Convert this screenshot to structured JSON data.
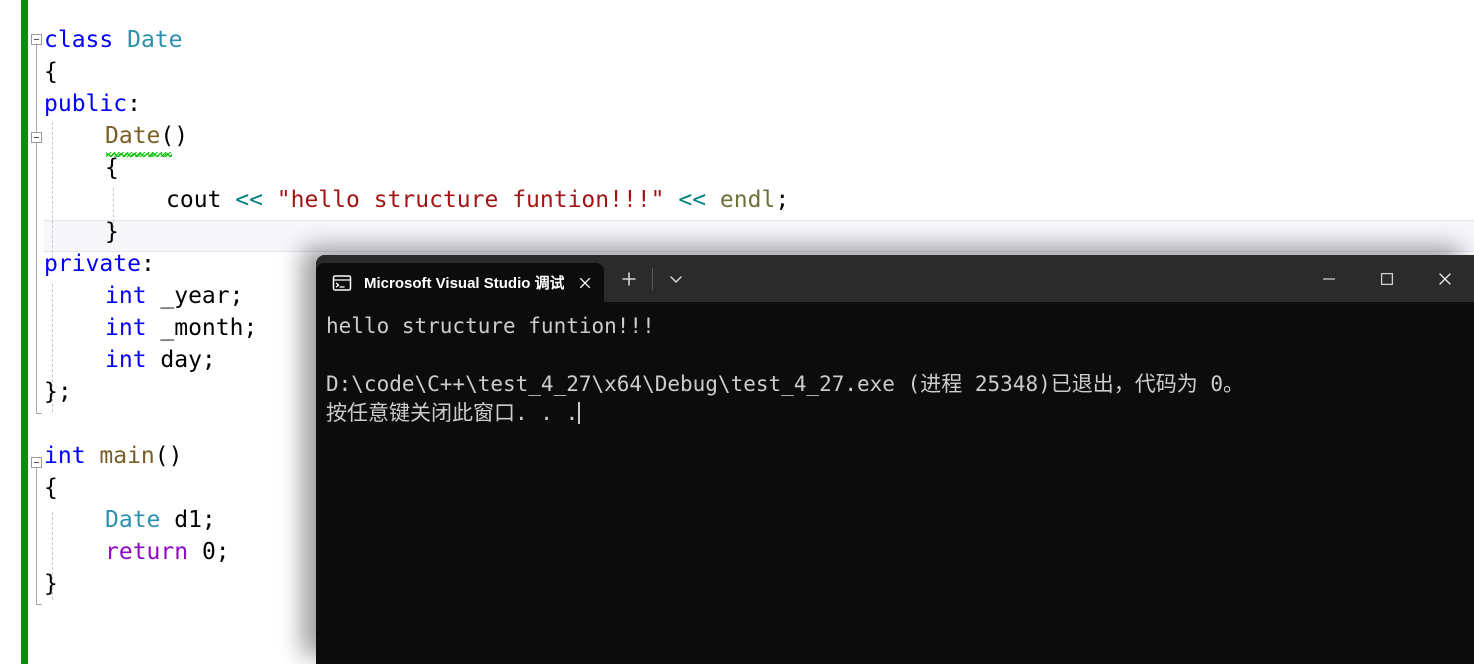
{
  "editor": {
    "name": "visual-studio-code-editor",
    "colors": {
      "background": "#ffffff",
      "change_bar": "#108b10",
      "keyword": "#0000ff",
      "control_keyword": "#8f08c4",
      "type": "#2b91af",
      "function": "#795e26",
      "string": "#a31515",
      "operator": "#008080",
      "macro": "#6f6f3a",
      "current_line_bg": "#f6f6fb",
      "error_squiggle": "#00cc00"
    },
    "lines": [
      {
        "indent": 0,
        "tokens": [
          {
            "t": "class ",
            "c": "kw"
          },
          {
            "t": "Date",
            "c": "type"
          }
        ]
      },
      {
        "indent": 0,
        "tokens": [
          {
            "t": "{",
            "c": "brace"
          }
        ]
      },
      {
        "indent": 0,
        "tokens": [
          {
            "t": "public",
            "c": "kw"
          },
          {
            "t": ":",
            "c": "ident"
          }
        ]
      },
      {
        "indent": 1,
        "tokens": [
          {
            "t": "Date",
            "c": "fn"
          },
          {
            "t": "()",
            "c": "brace"
          }
        ]
      },
      {
        "indent": 1,
        "tokens": [
          {
            "t": "{",
            "c": "brace"
          }
        ]
      },
      {
        "indent": 2,
        "tokens": [
          {
            "t": "cout ",
            "c": "ident"
          },
          {
            "t": "<< ",
            "c": "op"
          },
          {
            "t": "\"hello structure funtion!!!\"",
            "c": "str"
          },
          {
            "t": " << ",
            "c": "op"
          },
          {
            "t": "endl",
            "c": "macro"
          },
          {
            "t": ";",
            "c": "ident"
          }
        ]
      },
      {
        "indent": 1,
        "tokens": [
          {
            "t": "}",
            "c": "brace"
          }
        ]
      },
      {
        "indent": 0,
        "tokens": [
          {
            "t": "private",
            "c": "kw"
          },
          {
            "t": ":",
            "c": "ident"
          }
        ]
      },
      {
        "indent": 1,
        "tokens": [
          {
            "t": "int",
            "c": "kw"
          },
          {
            "t": " _year;",
            "c": "ident"
          }
        ]
      },
      {
        "indent": 1,
        "tokens": [
          {
            "t": "int",
            "c": "kw"
          },
          {
            "t": " _month;",
            "c": "ident"
          }
        ]
      },
      {
        "indent": 1,
        "tokens": [
          {
            "t": "int",
            "c": "kw"
          },
          {
            "t": " day;",
            "c": "ident"
          }
        ]
      },
      {
        "indent": 0,
        "tokens": [
          {
            "t": "};",
            "c": "brace"
          }
        ]
      },
      {
        "indent": 0,
        "tokens": [
          {
            "t": "",
            "c": "ident"
          }
        ]
      },
      {
        "indent": 0,
        "tokens": [
          {
            "t": "int ",
            "c": "kw"
          },
          {
            "t": "main",
            "c": "fn"
          },
          {
            "t": "()",
            "c": "brace"
          }
        ]
      },
      {
        "indent": 0,
        "tokens": [
          {
            "t": "{",
            "c": "brace"
          }
        ]
      },
      {
        "indent": 1,
        "tokens": [
          {
            "t": "Date",
            "c": "type"
          },
          {
            "t": " d1;",
            "c": "ident"
          }
        ]
      },
      {
        "indent": 1,
        "tokens": [
          {
            "t": "return",
            "c": "kwv"
          },
          {
            "t": " 0;",
            "c": "ident"
          }
        ]
      },
      {
        "indent": 0,
        "tokens": [
          {
            "t": "}",
            "c": "brace"
          }
        ]
      }
    ],
    "current_line_index": 6,
    "error_underline_line_index": 3
  },
  "terminal": {
    "window_title": "Microsoft Visual Studio 调试控制台",
    "tab": {
      "title": "Microsoft Visual Studio 调试控",
      "icon": "console-icon",
      "close_label": "×"
    },
    "actions": {
      "new_tab_label": "+",
      "dropdown_label": "⌄"
    },
    "window_controls": {
      "minimize_label": "—",
      "maximize_label": "□",
      "close_label": "✕"
    },
    "colors": {
      "titlebar": "#2b2b2b",
      "body": "#0c0c0c",
      "text": "#cccccc"
    },
    "output_lines": [
      "hello structure funtion!!!",
      "",
      "D:\\code\\C++\\test_4_27\\x64\\Debug\\test_4_27.exe (进程 25348)已退出，代码为 0。",
      "按任意键关闭此窗口. . ."
    ]
  }
}
